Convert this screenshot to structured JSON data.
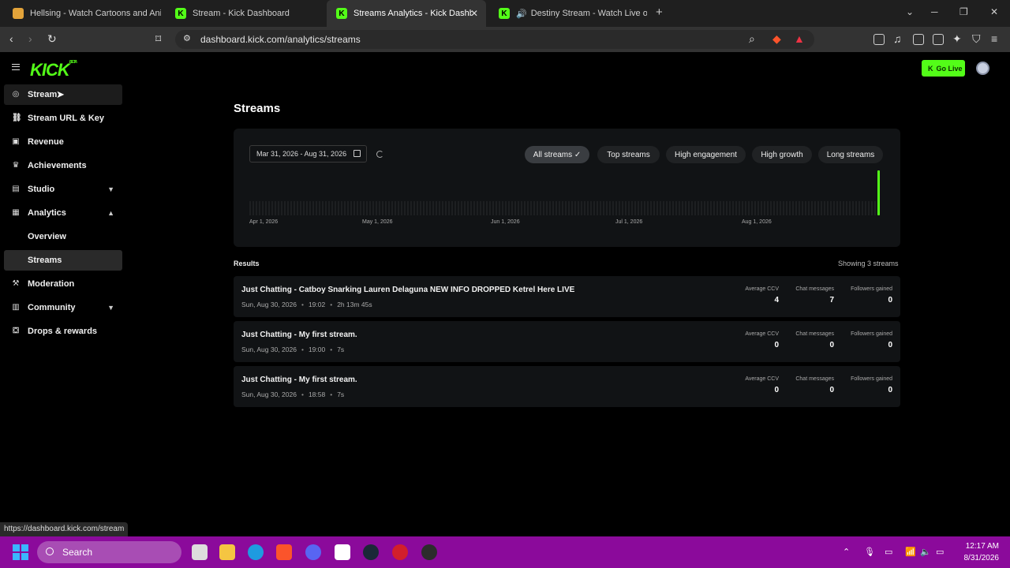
{
  "browser": {
    "tabs": [
      {
        "title": "Hellsing - Watch Cartoons and Anim",
        "favicon": "h"
      },
      {
        "title": "Stream - Kick Dashboard",
        "favicon": "k"
      },
      {
        "title": "Streams Analytics - Kick Dashbo",
        "favicon": "k"
      },
      {
        "title": "Destiny Stream - Watch Live on K",
        "favicon": "k"
      }
    ],
    "url": "dashboard.kick.com/analytics/streams",
    "status_url": "https://dashboard.kick.com/stream"
  },
  "header": {
    "logo": "KICK",
    "logo_tag": "BETA",
    "go_live": "Go Live"
  },
  "sidebar": {
    "items": [
      {
        "label": "Stream",
        "icon": "radio-icon"
      },
      {
        "label": "Stream URL & Key",
        "icon": "link-icon"
      },
      {
        "label": "Revenue",
        "icon": "wallet-icon"
      },
      {
        "label": "Achievements",
        "icon": "trophy-icon"
      },
      {
        "label": "Studio",
        "icon": "studio-icon"
      },
      {
        "label": "Analytics",
        "icon": "analytics-icon"
      },
      {
        "label": "Overview"
      },
      {
        "label": "Streams"
      },
      {
        "label": "Moderation",
        "icon": "hammer-icon"
      },
      {
        "label": "Community",
        "icon": "community-icon"
      },
      {
        "label": "Drops & rewards",
        "icon": "gift-icon"
      }
    ]
  },
  "main": {
    "title": "Streams",
    "date_range": "Mar 31, 2026 - Aug 31, 2026",
    "filters": [
      "All streams ✓",
      "Top streams",
      "High engagement",
      "High growth",
      "Long streams"
    ],
    "active_filter": "All streams",
    "results_label": "Results",
    "showing": "Showing 3 streams"
  },
  "chart_data": {
    "type": "bar",
    "x_ticks": [
      "Apr 1, 2026",
      "May 1, 2026",
      "Jun 1, 2026",
      "Jul 1, 2026",
      "Aug 1, 2026"
    ],
    "highlight_color": "#53fc18",
    "highlight_date": "Aug 30, 2026"
  },
  "streams": [
    {
      "title": "Just Chatting - Catboy Snarking Lauren Delaguna NEW INFO DROPPED Ketrel Here LIVE",
      "date": "Sun, Aug 30, 2026",
      "time": "19:02",
      "duration": "2h 13m 45s",
      "ccv_label": "Average CCV",
      "ccv": "4",
      "chat_label": "Chat messages",
      "chat": "7",
      "followers_label": "Followers gained",
      "followers": "0"
    },
    {
      "title": "Just Chatting - My first stream.",
      "date": "Sun, Aug 30, 2026",
      "time": "19:00",
      "duration": "7s",
      "ccv_label": "Average CCV",
      "ccv": "0",
      "chat_label": "Chat messages",
      "chat": "0",
      "followers_label": "Followers gained",
      "followers": "0"
    },
    {
      "title": "Just Chatting - My first stream.",
      "date": "Sun, Aug 30, 2026",
      "time": "18:58",
      "duration": "7s",
      "ccv_label": "Average CCV",
      "ccv": "0",
      "chat_label": "Chat messages",
      "chat": "0",
      "followers_label": "Followers gained",
      "followers": "0"
    }
  ],
  "taskbar": {
    "search": "Search",
    "time": "12:17 AM",
    "date": "8/31/2026"
  },
  "colors": {
    "accent": "#53fc18",
    "taskbar": "#8b0a9b"
  }
}
